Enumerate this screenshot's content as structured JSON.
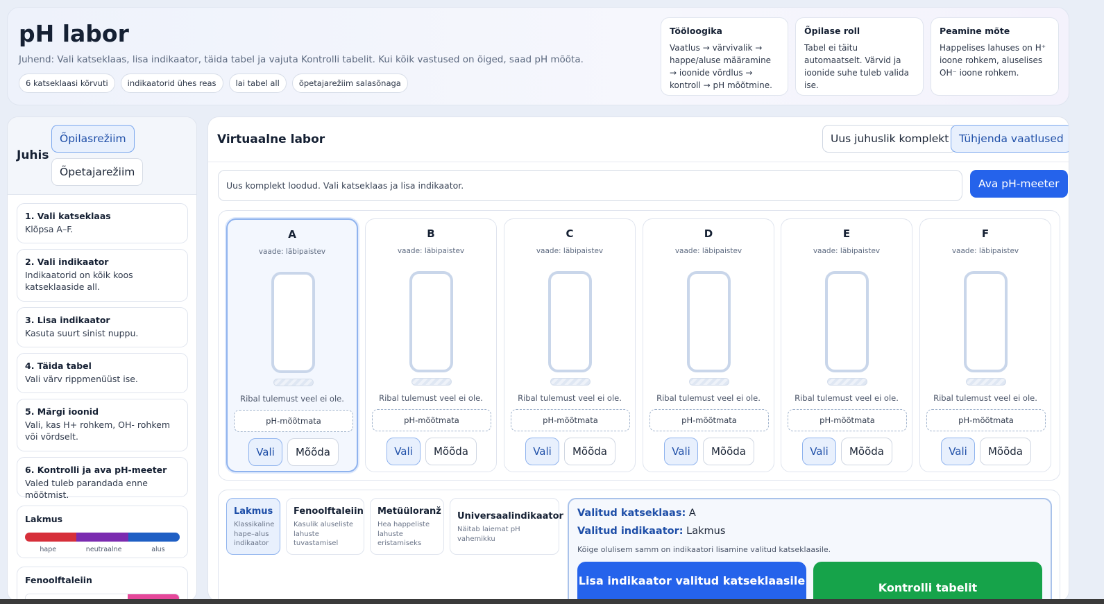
{
  "header": {
    "title": "pH labor",
    "instructions": "Juhend: Vali katseklaas, lisa indikaator, täida tabel ja vajuta Kontrolli tabelit. Kui kõik vastused on õiged, saad pH mõõta.",
    "chips": [
      "6 katseklaasi kõrvuti",
      "indikaatorid ühes reas",
      "lai tabel all",
      "õpetajarežiim salasõnaga"
    ],
    "cards": [
      {
        "title": "Tööloogika",
        "body": "Vaatlus → värvivalik → happe/aluse määramine → ioonide võrdlus → kontroll → pH mõõtmine."
      },
      {
        "title": "Õpilase roll",
        "body": "Tabel ei täitu automaatselt. Värvid ja ioonide suhe tuleb valida ise."
      },
      {
        "title": "Peamine mõte",
        "body": "Happelises lahuses on H⁺ ioone rohkem, aluselises OH⁻ ioone rohkem."
      }
    ]
  },
  "sidebar": {
    "title": "Juhis",
    "mode_student": "Õpilasrežiim",
    "mode_teacher": "Õpetajarežiim",
    "steps": [
      {
        "title": "1. Vali katseklaas",
        "body": "Klõpsa A–F."
      },
      {
        "title": "2. Vali indikaator",
        "body": "Indikaatorid on kõik koos katseklaaside all."
      },
      {
        "title": "3. Lisa indikaator",
        "body": "Kasuta suurt sinist nuppu."
      },
      {
        "title": "4. Täida tabel",
        "body": "Vali värv rippmenüüst ise."
      },
      {
        "title": "5. Märgi ioonid",
        "body": "Vali, kas H+ rohkem, OH- rohkem või võrdselt."
      },
      {
        "title": "6. Kontrolli ja ava pH-meeter",
        "body": "Valed tuleb parandada enne mõõtmist."
      }
    ],
    "scales": [
      {
        "title": "Lakmus",
        "labels": [
          "hape",
          "neutraalne",
          "alus"
        ],
        "colors": [
          "#d62f3a",
          "#7b2bb0",
          "#1f5fc4"
        ]
      },
      {
        "title": "Fenoolftaleiin",
        "colors": [
          "#ffffff",
          "#ffffff",
          "#e5489a"
        ]
      }
    ]
  },
  "lab": {
    "title": "Virtuaalne labor",
    "btn_new": "Uus juhuslik komplekt",
    "btn_clear": "Tühjenda vaatlused",
    "status": "Uus komplekt loodud. Vali katseklaas ja lisa indikaator.",
    "btn_ph": "Ava pH-meeter",
    "tubes": [
      {
        "letter": "A",
        "view": "vaade: läbipaistev",
        "note": "Ribal tulemust veel ei ole.",
        "ph": "pH-mõõtmata",
        "select": "Vali",
        "measure": "Mõõda"
      },
      {
        "letter": "B",
        "view": "vaade: läbipaistev",
        "note": "Ribal tulemust veel ei ole.",
        "ph": "pH-mõõtmata",
        "select": "Vali",
        "measure": "Mõõda"
      },
      {
        "letter": "C",
        "view": "vaade: läbipaistev",
        "note": "Ribal tulemust veel ei ole.",
        "ph": "pH-mõõtmata",
        "select": "Vali",
        "measure": "Mõõda"
      },
      {
        "letter": "D",
        "view": "vaade: läbipaistev",
        "note": "Ribal tulemust veel ei ole.",
        "ph": "pH-mõõtmata",
        "select": "Vali",
        "measure": "Mõõda"
      },
      {
        "letter": "E",
        "view": "vaade: läbipaistev",
        "note": "Ribal tulemust veel ei ole.",
        "ph": "pH-mõõtmata",
        "select": "Vali",
        "measure": "Mõõda"
      },
      {
        "letter": "F",
        "view": "vaade: läbipaistev",
        "note": "Ribal tulemust veel ei ole.",
        "ph": "pH-mõõtmata",
        "select": "Vali",
        "measure": "Mõõda"
      }
    ],
    "indicators": [
      {
        "name": "Lakmus",
        "desc": "Klassikaline hape–alus indikaator"
      },
      {
        "name": "Fenoolftaleiin",
        "desc": "Kasulik aluseliste lahuste tuvastamisel"
      },
      {
        "name": "Metüüloranž",
        "desc": "Hea happeliste lahuste eristamiseks"
      },
      {
        "name": "Universaalindikaator",
        "desc": "Näitab laiemat pH vahemikku"
      }
    ],
    "selection": {
      "tube_label": "Valitud katseklaas:",
      "tube_value": "A",
      "indicator_label": "Valitud indikaator:",
      "indicator_value": "Lakmus",
      "hint": "Kõige olulisem samm on indikaatori lisamine valitud katseklaasile.",
      "btn_add": "Lisa indikaator valitud katseklaasile",
      "btn_check": "Kontrolli tabelit"
    }
  }
}
